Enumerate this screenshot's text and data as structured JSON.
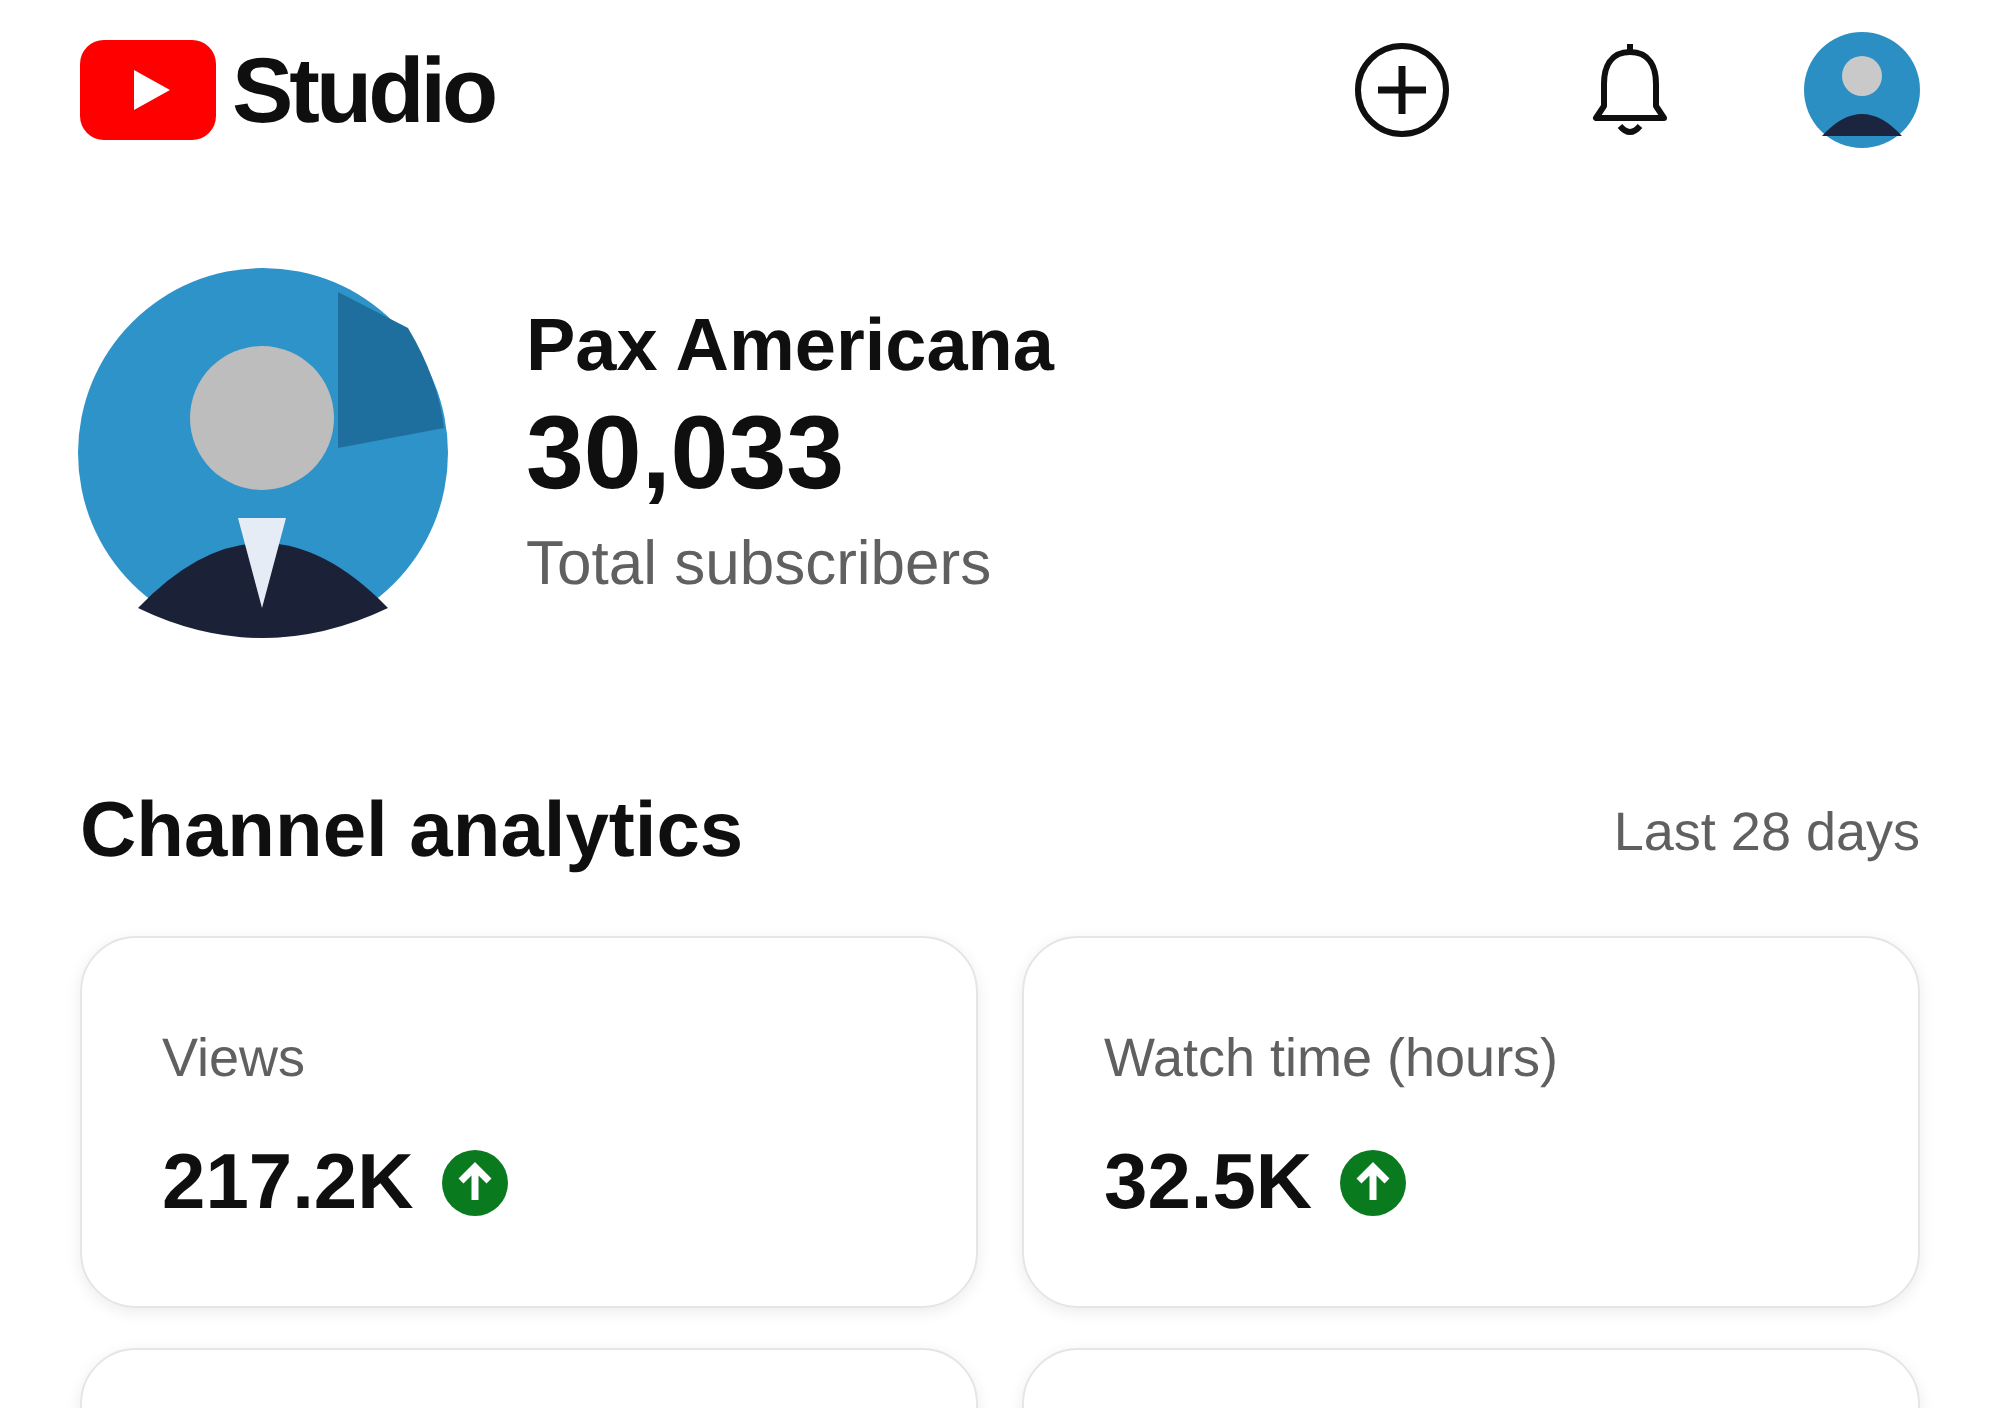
{
  "header": {
    "logo_text": "Studio"
  },
  "channel": {
    "name": "Pax Americana",
    "subscribers": "30,033",
    "subscribers_label": "Total subscribers"
  },
  "analytics": {
    "title": "Channel analytics",
    "period": "Last 28 days",
    "metrics": [
      {
        "label": "Views",
        "value": "217.2K",
        "rising": true
      },
      {
        "label": "Watch time (hours)",
        "value": "32.5K",
        "rising": true
      }
    ]
  }
}
